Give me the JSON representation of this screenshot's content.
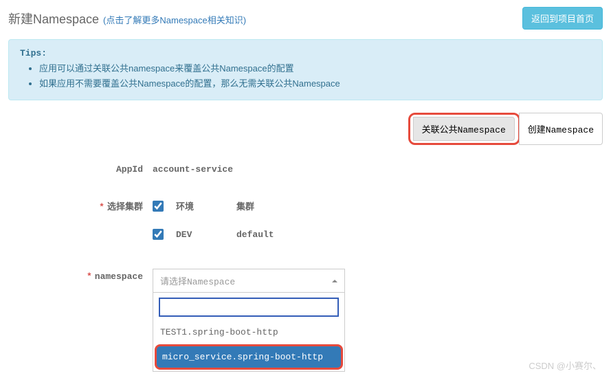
{
  "header": {
    "title": "新建Namespace",
    "more_link": "(点击了解更多Namespace相关知识)",
    "back_button": "返回到项目首页"
  },
  "tips": {
    "label": "Tips:",
    "items": [
      "应用可以通过关联公共namespace来覆盖公共Namespace的配置",
      "如果应用不需要覆盖公共Namespace的配置，那么无需关联公共Namespace"
    ]
  },
  "tab_buttons": {
    "link_public": "关联公共Namespace",
    "create": "创建Namespace"
  },
  "form": {
    "appid_label": "AppId",
    "appid_value": "account-service",
    "cluster_label": "选择集群",
    "cluster_header_env": "环境",
    "cluster_header_cluster": "集群",
    "cluster_rows": [
      {
        "env": "DEV",
        "cluster": "default",
        "checked": true
      }
    ],
    "ns_label": "namespace",
    "ns_placeholder": "请选择Namespace",
    "ns_search": "",
    "ns_options": [
      {
        "value": "TEST1.spring-boot-http",
        "highlighted": false
      },
      {
        "value": "micro_service.spring-boot-http",
        "highlighted": true
      }
    ]
  },
  "watermark": "CSDN @小赛尔、"
}
